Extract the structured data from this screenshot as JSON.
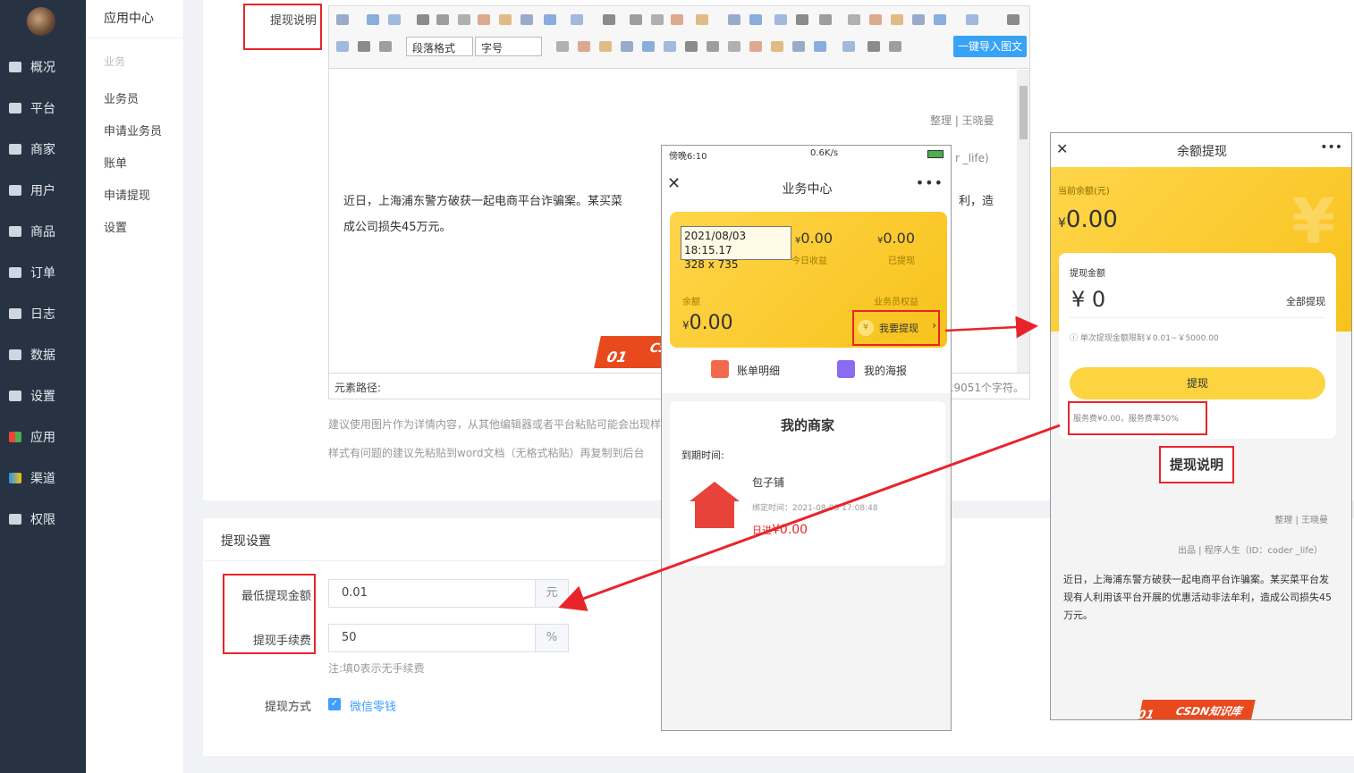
{
  "sidebar": {
    "items": [
      {
        "label": "概况",
        "icon": "dashboard-icon"
      },
      {
        "label": "平台",
        "icon": "monitor-icon"
      },
      {
        "label": "商家",
        "icon": "store-icon"
      },
      {
        "label": "用户",
        "icon": "user-icon"
      },
      {
        "label": "商品",
        "icon": "goods-icon"
      },
      {
        "label": "订单",
        "icon": "order-icon"
      },
      {
        "label": "日志",
        "icon": "log-icon"
      },
      {
        "label": "数据",
        "icon": "chart-icon"
      },
      {
        "label": "设置",
        "icon": "gear-icon"
      },
      {
        "label": "应用",
        "icon": "apps-icon"
      },
      {
        "label": "渠道",
        "icon": "cube-icon"
      },
      {
        "label": "权限",
        "icon": "lock-icon"
      }
    ]
  },
  "subnav": {
    "head": "应用中心",
    "section": "业务",
    "items": [
      "业务员",
      "申请业务员",
      "账单",
      "申请提现",
      "设置"
    ]
  },
  "form": {
    "desc_label": "提现说明",
    "editor": {
      "paragraph_select": "段落格式",
      "fontsize_select": "字号",
      "import_button": "一键导入图文",
      "meta1": "整理 | 王晓曼",
      "meta2": "r _life)",
      "body": "近日，上海浦东警方破获一起电商平台诈骗案。某买菜",
      "body2": "利，造",
      "body3": "成公司损失45万元。",
      "path_label": "元素路径:",
      "char_count": "入19051个字符。"
    },
    "hint1": "建议使用图片作为详情内容，从其他编辑器或者平台粘贴可能会出现样",
    "hint2": "样式有问题的建议先粘贴到word文档（无格式粘贴）再复制到后台",
    "withdraw_settings_title": "提现设置",
    "min_label": "最低提现金额",
    "min_value": "0.01",
    "min_unit": "元",
    "fee_label": "提现手续费",
    "fee_value": "50",
    "fee_unit": "%",
    "fee_note": "注:填0表示无手续费",
    "method_label": "提现方式",
    "method_option": "微信零钱"
  },
  "phone1": {
    "status_left": "傍晚6:10",
    "status_right": "0.6K/s",
    "title": "业务中心",
    "tooltip_line1": "2021/08/03 18:15.17",
    "tooltip_line2": "328 x 735",
    "today_amount": "0.00",
    "today_label": "今日收益",
    "withdrawn_amount": "0.00",
    "withdrawn_label": "已提现",
    "balance_label": "余额",
    "rights_label": "业务员权益",
    "balance_amount": "0.00",
    "yen": "¥",
    "withdraw_btn": "我要提现",
    "bill_label": "账单明细",
    "poster_label": "我的海报",
    "merchants_title": "我的商家",
    "expire_label": "到期时间:",
    "shop_name": "包子铺",
    "bind_time": "绑定时间：2021-08-03 17:08:48",
    "shop_amount": "0.00",
    "shop_amount_prefix": "日进"
  },
  "phone2": {
    "title": "余额提现",
    "balance_label": "当前余额(元)",
    "balance": "0.00",
    "yen": "¥",
    "amount_label": "提现金额",
    "amount_value": "0",
    "all_btn": "全部提现",
    "limit_note": "单次提现金额限制￥0.01~￥5000.00",
    "submit_btn": "提现",
    "fee_note": "服务费¥0.00，服务费率50%",
    "desc_title": "提现说明",
    "meta1": "整理 | 王晓曼",
    "meta2": "出品 | 程序人生（ID：coder _life）",
    "article": "近日，上海浦东警方破获一起电商平台诈骗案。某买菜平台发现有人利用该平台开展的优惠活动非法牟利，造成公司损失45万元。"
  },
  "watermark": {
    "num": "01",
    "text": "CSDN知识库",
    "text_short": "CS"
  },
  "colors": {
    "sidebar": "#273343",
    "accent_red": "#e8242a",
    "yellow": "#f7c21b",
    "blue": "#38a3f5"
  }
}
